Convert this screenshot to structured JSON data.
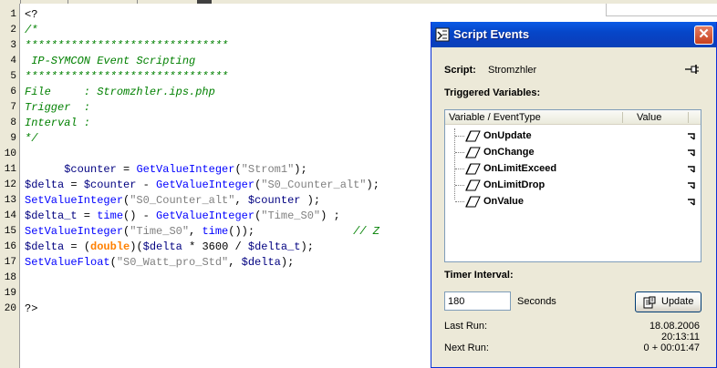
{
  "editor": {
    "line_numbers": [
      "1",
      "2",
      "3",
      "4",
      "5",
      "6",
      "7",
      "8",
      "9",
      "10",
      "11",
      "12",
      "13",
      "14",
      "15",
      "16",
      "17",
      "18",
      "19",
      "20"
    ],
    "lines": [
      [
        {
          "t": "<?",
          "c": "op"
        }
      ],
      [
        {
          "t": "/*",
          "c": "cmt"
        }
      ],
      [
        {
          "t": "*******************************",
          "c": "cmt"
        }
      ],
      [
        {
          "t": " IP-SYMCON Event Scripting",
          "c": "cmt"
        }
      ],
      [
        {
          "t": "*******************************",
          "c": "cmt"
        }
      ],
      [
        {
          "t": "File     : Stromzhler.ips.php",
          "c": "cmt"
        }
      ],
      [
        {
          "t": "Trigger  :",
          "c": "cmt"
        }
      ],
      [
        {
          "t": "Interval :",
          "c": "cmt"
        }
      ],
      [
        {
          "t": "*/",
          "c": "cmt"
        }
      ],
      [],
      [
        {
          "t": "      $counter",
          "c": "var"
        },
        {
          "t": " = ",
          "c": "op"
        },
        {
          "t": "GetValueInteger",
          "c": "fn"
        },
        {
          "t": "(",
          "c": "op"
        },
        {
          "t": "\"Strom1\"",
          "c": "str"
        },
        {
          "t": ");",
          "c": "op"
        }
      ],
      [
        {
          "t": "$delta",
          "c": "var"
        },
        {
          "t": " = ",
          "c": "op"
        },
        {
          "t": "$counter",
          "c": "var"
        },
        {
          "t": " - ",
          "c": "op"
        },
        {
          "t": "GetValueInteger",
          "c": "fn"
        },
        {
          "t": "(",
          "c": "op"
        },
        {
          "t": "\"S0_Counter_alt\"",
          "c": "str"
        },
        {
          "t": ");",
          "c": "op"
        }
      ],
      [
        {
          "t": "SetValueInteger",
          "c": "fn"
        },
        {
          "t": "(",
          "c": "op"
        },
        {
          "t": "\"S0_Counter_alt\"",
          "c": "str"
        },
        {
          "t": ", ",
          "c": "op"
        },
        {
          "t": "$counter",
          "c": "var"
        },
        {
          "t": " );",
          "c": "op"
        }
      ],
      [
        {
          "t": "$delta_t",
          "c": "var"
        },
        {
          "t": " = ",
          "c": "op"
        },
        {
          "t": "time",
          "c": "fn"
        },
        {
          "t": "() - ",
          "c": "op"
        },
        {
          "t": "GetValueInteger",
          "c": "fn"
        },
        {
          "t": "(",
          "c": "op"
        },
        {
          "t": "\"Time_S0\"",
          "c": "str"
        },
        {
          "t": ") ;",
          "c": "op"
        }
      ],
      [
        {
          "t": "SetValueInteger",
          "c": "fn"
        },
        {
          "t": "(",
          "c": "op"
        },
        {
          "t": "\"Time_S0\"",
          "c": "str"
        },
        {
          "t": ", ",
          "c": "op"
        },
        {
          "t": "time",
          "c": "fn"
        },
        {
          "t": "());",
          "c": "op"
        },
        {
          "t": "               // Z",
          "c": "cmt"
        }
      ],
      [
        {
          "t": "$delta",
          "c": "var"
        },
        {
          "t": " = (",
          "c": "op"
        },
        {
          "t": "double",
          "c": "kw"
        },
        {
          "t": ")(",
          "c": "op"
        },
        {
          "t": "$delta",
          "c": "var"
        },
        {
          "t": " * 3600 / ",
          "c": "op"
        },
        {
          "t": "$delta_t",
          "c": "var"
        },
        {
          "t": ");",
          "c": "op"
        }
      ],
      [
        {
          "t": "SetValueFloat",
          "c": "fn"
        },
        {
          "t": "(",
          "c": "op"
        },
        {
          "t": "\"S0_Watt_pro_Std\"",
          "c": "str"
        },
        {
          "t": ", ",
          "c": "op"
        },
        {
          "t": "$delta",
          "c": "var"
        },
        {
          "t": ");",
          "c": "op"
        }
      ],
      [],
      [],
      [
        {
          "t": "?>",
          "c": "op"
        }
      ]
    ]
  },
  "dialog": {
    "title": "Script Events",
    "close_glyph": "✕",
    "script_label": "Script:",
    "script_name": "Stromzhler",
    "triggered_label": "Triggered Variables:",
    "columns": {
      "variable": "Variable / EventType",
      "value": "Value"
    },
    "events": [
      "OnUpdate",
      "OnChange",
      "OnLimitExceed",
      "OnLimitDrop",
      "OnValue"
    ],
    "timer_label": "Timer Interval:",
    "timer_value": "180",
    "timer_unit": "Seconds",
    "update_label": "Update",
    "last_run_label": "Last Run:",
    "last_run_value": "18.08.2006 20:13:11",
    "next_run_label": "Next Run:",
    "next_run_value": "0 + 00:01:47"
  },
  "colors": {
    "comment": "#008000",
    "variable": "#000080",
    "function": "#0000ff",
    "string": "#808080",
    "keyword": "#ff8000",
    "titlebar": "#0a4fd6"
  },
  "icons": [
    "script-events-icon",
    "close-icon",
    "pin-icon",
    "event-icon",
    "value-marker-icon",
    "update-icon"
  ]
}
